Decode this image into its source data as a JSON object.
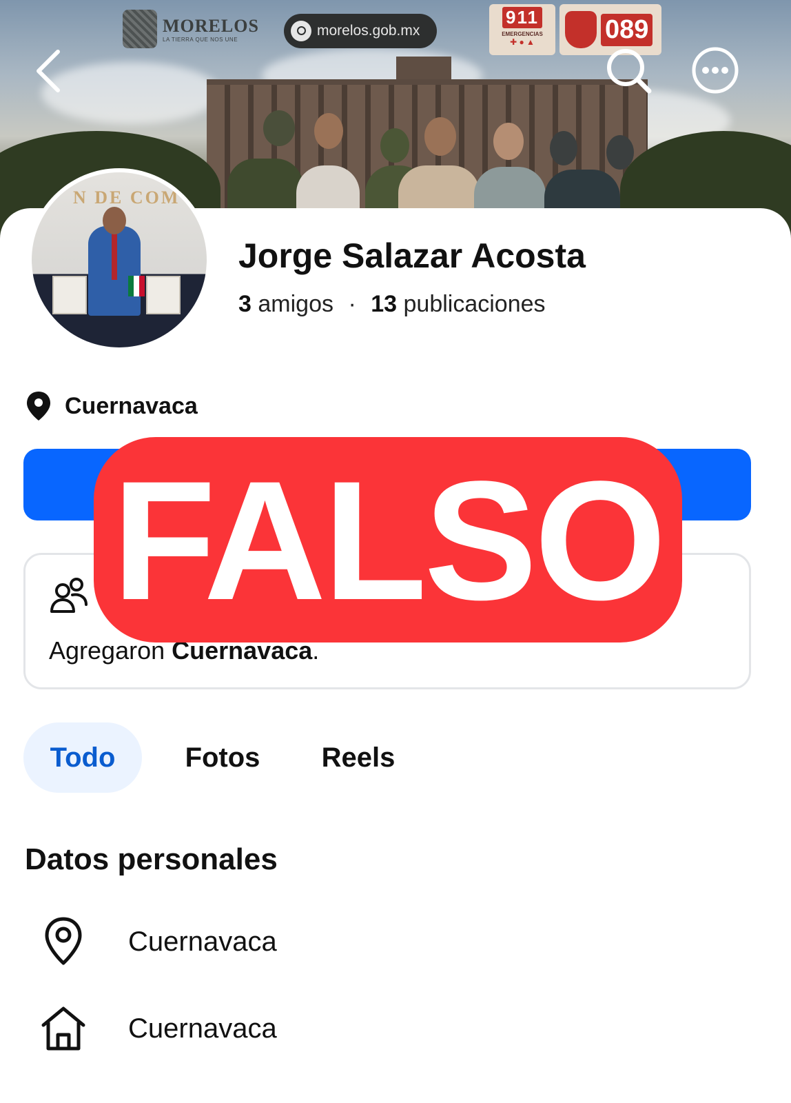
{
  "cover": {
    "brand_name": "MORELOS",
    "brand_tagline": "LA TIERRA QUE NOS UNE",
    "url": "morelos.gob.mx",
    "badge_911": "911",
    "badge_911_label": "EMERGENCIAS",
    "badge_089": "089",
    "wall_text": "N DE COM"
  },
  "profile": {
    "name": "Jorge Salazar Acosta",
    "friends_count": "3",
    "friends_label": "amigos",
    "posts_count": "13",
    "posts_label": "publicaciones",
    "separator": "·",
    "location": "Cuernavaca"
  },
  "info_box": {
    "message_prefix": "Agregaron",
    "message_place": "Cuernavaca",
    "message_suffix": "."
  },
  "stamp": {
    "text": "FALSO",
    "color": "#fb3438"
  },
  "tabs": [
    {
      "label": "Todo",
      "active": true
    },
    {
      "label": "Fotos",
      "active": false
    },
    {
      "label": "Reels",
      "active": false
    }
  ],
  "personal_data": {
    "title": "Datos personales",
    "items": [
      {
        "icon": "location-pin-icon",
        "text": "Cuernavaca"
      },
      {
        "icon": "home-icon",
        "text": "Cuernavaca"
      }
    ]
  },
  "colors": {
    "primary_blue": "#0866ff",
    "active_tab_bg": "#ebf3ff",
    "active_tab_text": "#0a5ccf"
  }
}
